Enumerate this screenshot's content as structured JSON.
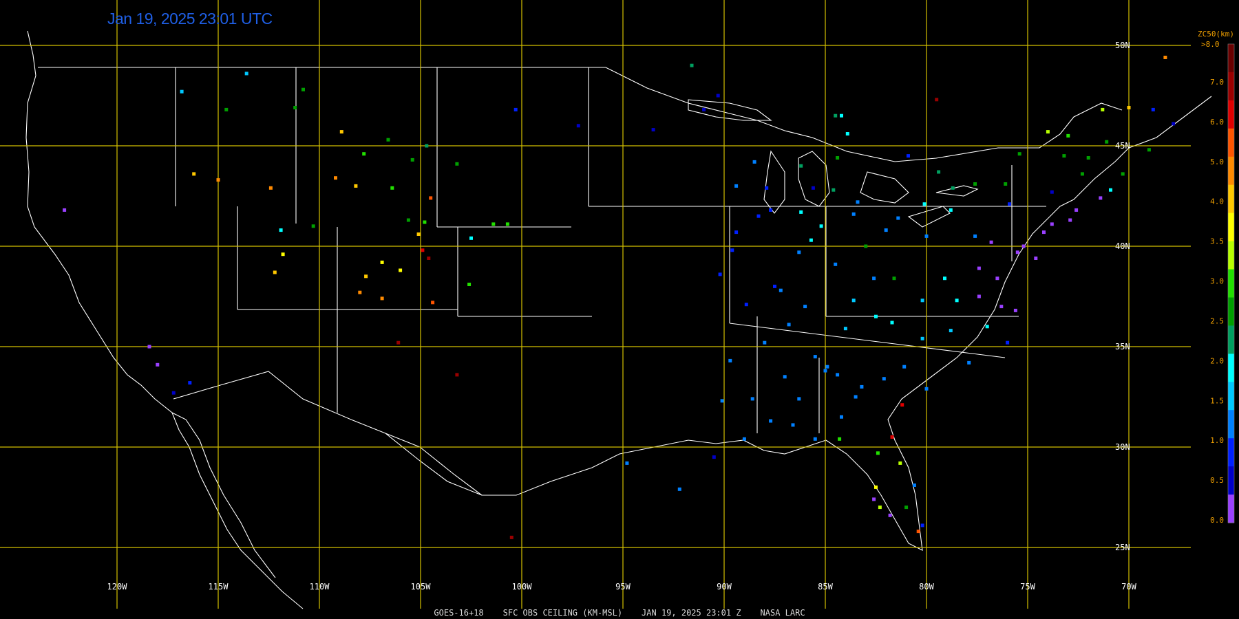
{
  "timestamp": "Jan 19, 2025 23:01 UTC",
  "footer": {
    "product": "GOES-16+18",
    "variable": "SFC OBS CEILING (KM-MSL)",
    "datetime": "JAN 19, 2025 23:01 Z",
    "source": "NASA LARC"
  },
  "colorbar": {
    "title": "ZC50(km)",
    "top_label": ">8.0",
    "labels": [
      "7.0",
      "6.0",
      "5.0",
      "4.0",
      "3.5",
      "3.0",
      "2.5",
      "2.0",
      "1.5",
      "1.0",
      "0.5",
      "0.0"
    ],
    "colors": [
      "#6a0000",
      "#9a0000",
      "#e00000",
      "#ff5500",
      "#ff8a00",
      "#ffc800",
      "#ffff00",
      "#b8ff00",
      "#22e000",
      "#00a000",
      "#00a060",
      "#00ffff",
      "#00c8ff",
      "#0080ff",
      "#0020ff",
      "#0000c8",
      "#9a40ff"
    ]
  },
  "colors": {
    "grid": "#d4c000",
    "border": "#ffffff",
    "background": "#000000",
    "timestamp": "#1f5fe6"
  },
  "grid": {
    "lon_labels": [
      "120W",
      "115W",
      "110W",
      "105W",
      "100W",
      "95W",
      "90W",
      "85W",
      "80W",
      "75W",
      "70W"
    ],
    "lat_labels": [
      "50N",
      "45N",
      "40N",
      "35N",
      "30N",
      "25N"
    ]
  },
  "observations": [
    {
      "lon": -113.6,
      "lat": 48.6,
      "c": "#00c8ff"
    },
    {
      "lon": -110.8,
      "lat": 47.8,
      "c": "#00a000"
    },
    {
      "lon": -111.2,
      "lat": 46.9,
      "c": "#00a000"
    },
    {
      "lon": -108.9,
      "lat": 45.7,
      "c": "#ffc800"
    },
    {
      "lon": -106.6,
      "lat": 45.3,
      "c": "#00a000"
    },
    {
      "lon": -104.7,
      "lat": 45.0,
      "c": "#00a060"
    },
    {
      "lon": -107.8,
      "lat": 44.6,
      "c": "#22e000"
    },
    {
      "lon": -105.4,
      "lat": 44.3,
      "c": "#00a000"
    },
    {
      "lon": -103.2,
      "lat": 44.1,
      "c": "#00a000"
    },
    {
      "lon": -109.2,
      "lat": 43.4,
      "c": "#ff8a00"
    },
    {
      "lon": -108.2,
      "lat": 43.0,
      "c": "#ffc800"
    },
    {
      "lon": -106.4,
      "lat": 42.9,
      "c": "#22e000"
    },
    {
      "lon": -104.5,
      "lat": 42.4,
      "c": "#ff5500"
    },
    {
      "lon": -105.6,
      "lat": 41.3,
      "c": "#00a000"
    },
    {
      "lon": -104.8,
      "lat": 41.2,
      "c": "#22e000"
    },
    {
      "lon": -105.1,
      "lat": 40.6,
      "c": "#ffc800"
    },
    {
      "lon": -104.9,
      "lat": 39.8,
      "c": "#e00000"
    },
    {
      "lon": -104.6,
      "lat": 39.4,
      "c": "#9a0000"
    },
    {
      "lon": -106.9,
      "lat": 39.2,
      "c": "#ffff00"
    },
    {
      "lon": -107.7,
      "lat": 38.5,
      "c": "#ffc800"
    },
    {
      "lon": -106.0,
      "lat": 38.8,
      "c": "#ffff00"
    },
    {
      "lon": -108.0,
      "lat": 37.7,
      "c": "#ff8a00"
    },
    {
      "lon": -106.9,
      "lat": 37.4,
      "c": "#ff8a00"
    },
    {
      "lon": -104.4,
      "lat": 37.2,
      "c": "#ff5500"
    },
    {
      "lon": -102.6,
      "lat": 38.1,
      "c": "#22e000"
    },
    {
      "lon": -102.5,
      "lat": 40.4,
      "c": "#00ffff"
    },
    {
      "lon": -101.4,
      "lat": 41.1,
      "c": "#22e000"
    },
    {
      "lon": -100.7,
      "lat": 41.1,
      "c": "#22e000"
    },
    {
      "lon": -116.2,
      "lat": 43.6,
      "c": "#ffc800"
    },
    {
      "lon": -115.0,
      "lat": 43.3,
      "c": "#ff8a00"
    },
    {
      "lon": -112.4,
      "lat": 42.9,
      "c": "#ff8a00"
    },
    {
      "lon": -111.9,
      "lat": 40.8,
      "c": "#00ffff"
    },
    {
      "lon": -110.3,
      "lat": 41.0,
      "c": "#00a000"
    },
    {
      "lon": -111.8,
      "lat": 39.6,
      "c": "#ffff00"
    },
    {
      "lon": -112.2,
      "lat": 38.7,
      "c": "#ffc800"
    },
    {
      "lon": -122.6,
      "lat": 41.8,
      "c": "#9a40ff"
    },
    {
      "lon": -118.4,
      "lat": 35.0,
      "c": "#9a40ff"
    },
    {
      "lon": -118.0,
      "lat": 34.1,
      "c": "#9a40ff"
    },
    {
      "lon": -117.2,
      "lat": 32.7,
      "c": "#0000c8"
    },
    {
      "lon": -116.4,
      "lat": 33.2,
      "c": "#0020ff"
    },
    {
      "lon": -114.6,
      "lat": 46.8,
      "c": "#00a000"
    },
    {
      "lon": -116.8,
      "lat": 47.7,
      "c": "#00c8ff"
    },
    {
      "lon": -100.3,
      "lat": 46.8,
      "c": "#0020ff"
    },
    {
      "lon": -97.2,
      "lat": 46.0,
      "c": "#0000c8"
    },
    {
      "lon": -106.1,
      "lat": 35.2,
      "c": "#9a0000"
    },
    {
      "lon": -103.2,
      "lat": 33.6,
      "c": "#9a0000"
    },
    {
      "lon": -100.5,
      "lat": 25.5,
      "c": "#9a0000"
    },
    {
      "lon": -94.8,
      "lat": 29.2,
      "c": "#0080ff"
    },
    {
      "lon": -92.2,
      "lat": 27.9,
      "c": "#0080ff"
    },
    {
      "lon": -90.5,
      "lat": 29.5,
      "c": "#0000c8"
    },
    {
      "lon": -87.0,
      "lat": 33.5,
      "c": "#0080ff"
    },
    {
      "lon": -86.3,
      "lat": 32.4,
      "c": "#0080ff"
    },
    {
      "lon": -85.0,
      "lat": 33.8,
      "c": "#0080ff"
    },
    {
      "lon": -84.4,
      "lat": 33.6,
      "c": "#0080ff"
    },
    {
      "lon": -83.5,
      "lat": 32.5,
      "c": "#0080ff"
    },
    {
      "lon": -86.8,
      "lat": 36.1,
      "c": "#0080ff"
    },
    {
      "lon": -85.5,
      "lat": 34.5,
      "c": "#0080ff"
    },
    {
      "lon": -84.0,
      "lat": 35.9,
      "c": "#00c8ff"
    },
    {
      "lon": -82.5,
      "lat": 36.5,
      "c": "#00ffff"
    },
    {
      "lon": -81.7,
      "lat": 36.2,
      "c": "#00ffff"
    },
    {
      "lon": -80.2,
      "lat": 35.4,
      "c": "#00c8ff"
    },
    {
      "lon": -84.5,
      "lat": 39.1,
      "c": "#0080ff"
    },
    {
      "lon": -83.0,
      "lat": 40.0,
      "c": "#00a000"
    },
    {
      "lon": -82.0,
      "lat": 40.8,
      "c": "#0080ff"
    },
    {
      "lon": -80.0,
      "lat": 40.5,
      "c": "#0080ff"
    },
    {
      "lon": -78.8,
      "lat": 41.8,
      "c": "#00ffff"
    },
    {
      "lon": -77.6,
      "lat": 40.5,
      "c": "#0080ff"
    },
    {
      "lon": -76.8,
      "lat": 40.2,
      "c": "#9a40ff"
    },
    {
      "lon": -75.2,
      "lat": 40.0,
      "c": "#9a40ff"
    },
    {
      "lon": -74.2,
      "lat": 40.7,
      "c": "#9a40ff"
    },
    {
      "lon": -73.8,
      "lat": 41.1,
      "c": "#9a40ff"
    },
    {
      "lon": -72.6,
      "lat": 41.8,
      "c": "#9a40ff"
    },
    {
      "lon": -71.4,
      "lat": 42.4,
      "c": "#9a40ff"
    },
    {
      "lon": -70.9,
      "lat": 42.8,
      "c": "#00ffff"
    },
    {
      "lon": -77.4,
      "lat": 38.9,
      "c": "#9a40ff"
    },
    {
      "lon": -76.5,
      "lat": 38.4,
      "c": "#9a40ff"
    },
    {
      "lon": -76.3,
      "lat": 37.0,
      "c": "#9a40ff"
    },
    {
      "lon": -77.4,
      "lat": 37.5,
      "c": "#9a40ff"
    },
    {
      "lon": -75.6,
      "lat": 36.8,
      "c": "#9a40ff"
    },
    {
      "lon": -76.0,
      "lat": 35.2,
      "c": "#0020ff"
    },
    {
      "lon": -77.9,
      "lat": 34.2,
      "c": "#0080ff"
    },
    {
      "lon": -80.0,
      "lat": 32.9,
      "c": "#0080ff"
    },
    {
      "lon": -81.2,
      "lat": 32.1,
      "c": "#e00000"
    },
    {
      "lon": -81.7,
      "lat": 30.5,
      "c": "#e00000"
    },
    {
      "lon": -82.4,
      "lat": 29.7,
      "c": "#22e000"
    },
    {
      "lon": -81.3,
      "lat": 29.2,
      "c": "#b8ff00"
    },
    {
      "lon": -82.5,
      "lat": 28.0,
      "c": "#ffff00"
    },
    {
      "lon": -82.6,
      "lat": 27.4,
      "c": "#9a40ff"
    },
    {
      "lon": -81.8,
      "lat": 26.6,
      "c": "#9a40ff"
    },
    {
      "lon": -80.6,
      "lat": 28.1,
      "c": "#0080ff"
    },
    {
      "lon": -80.2,
      "lat": 26.1,
      "c": "#0020ff"
    },
    {
      "lon": -80.4,
      "lat": 25.8,
      "c": "#ff5500"
    },
    {
      "lon": -81.0,
      "lat": 27.0,
      "c": "#00a000"
    },
    {
      "lon": -85.6,
      "lat": 42.9,
      "c": "#0000c8"
    },
    {
      "lon": -84.6,
      "lat": 42.8,
      "c": "#00a060"
    },
    {
      "lon": -83.4,
      "lat": 42.2,
      "c": "#0080ff"
    },
    {
      "lon": -84.4,
      "lat": 44.4,
      "c": "#00a000"
    },
    {
      "lon": -86.2,
      "lat": 44.0,
      "c": "#00a060"
    },
    {
      "lon": -87.9,
      "lat": 42.9,
      "c": "#0020ff"
    },
    {
      "lon": -87.7,
      "lat": 41.8,
      "c": "#0020ff"
    },
    {
      "lon": -86.2,
      "lat": 41.7,
      "c": "#00ffff"
    },
    {
      "lon": -89.6,
      "lat": 39.8,
      "c": "#0020ff"
    },
    {
      "lon": -89.4,
      "lat": 40.7,
      "c": "#0020ff"
    },
    {
      "lon": -88.3,
      "lat": 41.5,
      "c": "#0020ff"
    },
    {
      "lon": -90.2,
      "lat": 38.6,
      "c": "#0020ff"
    },
    {
      "lon": -85.7,
      "lat": 40.3,
      "c": "#00ffff"
    },
    {
      "lon": -84.2,
      "lat": 46.5,
      "c": "#00ffff"
    },
    {
      "lon": -83.9,
      "lat": 45.6,
      "c": "#00ffff"
    },
    {
      "lon": -80.9,
      "lat": 44.5,
      "c": "#0020ff"
    },
    {
      "lon": -79.4,
      "lat": 43.7,
      "c": "#00a060"
    },
    {
      "lon": -77.6,
      "lat": 43.1,
      "c": "#00a000"
    },
    {
      "lon": -76.1,
      "lat": 43.1,
      "c": "#00a000"
    },
    {
      "lon": -75.4,
      "lat": 44.6,
      "c": "#00a000"
    },
    {
      "lon": -73.8,
      "lat": 42.7,
      "c": "#0000c8"
    },
    {
      "lon": -72.0,
      "lat": 44.4,
      "c": "#00a000"
    },
    {
      "lon": -71.1,
      "lat": 45.2,
      "c": "#00a000"
    },
    {
      "lon": -69.0,
      "lat": 44.8,
      "c": "#00a000"
    },
    {
      "lon": -68.8,
      "lat": 46.8,
      "c": "#0020ff"
    },
    {
      "lon": -67.8,
      "lat": 46.1,
      "c": "#0000c8"
    },
    {
      "lon": -66.0,
      "lat": 45.3,
      "c": "#0000c8"
    },
    {
      "lon": -63.5,
      "lat": 44.9,
      "c": "#0020ff"
    },
    {
      "lon": -70.0,
      "lat": 46.9,
      "c": "#ffc800"
    },
    {
      "lon": -71.3,
      "lat": 46.8,
      "c": "#b8ff00"
    },
    {
      "lon": -73.0,
      "lat": 45.5,
      "c": "#22e000"
    },
    {
      "lon": -74.0,
      "lat": 45.7,
      "c": "#b8ff00"
    },
    {
      "lon": -66.3,
      "lat": 50.2,
      "c": "#ff8a00"
    },
    {
      "lon": -68.2,
      "lat": 49.4,
      "c": "#ff8a00"
    },
    {
      "lon": -64.5,
      "lat": 48.8,
      "c": "#ff8a00"
    },
    {
      "lon": -79.5,
      "lat": 47.3,
      "c": "#9a0000"
    },
    {
      "lon": -84.5,
      "lat": 46.5,
      "c": "#00a060"
    },
    {
      "lon": -90.3,
      "lat": 47.5,
      "c": "#0000c8"
    },
    {
      "lon": -91.0,
      "lat": 46.8,
      "c": "#0000c8"
    },
    {
      "lon": -93.5,
      "lat": 45.8,
      "c": "#0000c8"
    },
    {
      "lon": -91.6,
      "lat": 49.0,
      "c": "#00a060"
    },
    {
      "lon": -88.5,
      "lat": 44.2,
      "c": "#0080ff"
    },
    {
      "lon": -89.4,
      "lat": 43.0,
      "c": "#0080ff"
    },
    {
      "lon": -87.2,
      "lat": 37.8,
      "c": "#0080ff"
    },
    {
      "lon": -86.0,
      "lat": 37.0,
      "c": "#0080ff"
    },
    {
      "lon": -83.6,
      "lat": 37.3,
      "c": "#00c8ff"
    },
    {
      "lon": -82.6,
      "lat": 38.4,
      "c": "#0080ff"
    },
    {
      "lon": -81.6,
      "lat": 38.4,
      "c": "#00a000"
    },
    {
      "lon": -80.2,
      "lat": 37.3,
      "c": "#00c8ff"
    },
    {
      "lon": -79.1,
      "lat": 38.4,
      "c": "#00ffff"
    },
    {
      "lon": -78.5,
      "lat": 37.3,
      "c": "#00ffff"
    },
    {
      "lon": -84.9,
      "lat": 34.0,
      "c": "#0080ff"
    },
    {
      "lon": -83.2,
      "lat": 33.0,
      "c": "#0080ff"
    },
    {
      "lon": -88.6,
      "lat": 32.4,
      "c": "#0080ff"
    },
    {
      "lon": -87.7,
      "lat": 31.3,
      "c": "#0080ff"
    },
    {
      "lon": -86.6,
      "lat": 31.1,
      "c": "#0080ff"
    },
    {
      "lon": -84.2,
      "lat": 31.5,
      "c": "#0080ff"
    },
    {
      "lon": -82.1,
      "lat": 33.4,
      "c": "#0080ff"
    },
    {
      "lon": -81.1,
      "lat": 34.0,
      "c": "#0080ff"
    },
    {
      "lon": -77.0,
      "lat": 36.0,
      "c": "#00ffff"
    },
    {
      "lon": -78.8,
      "lat": 35.8,
      "c": "#00c8ff"
    },
    {
      "lon": -75.5,
      "lat": 39.7,
      "c": "#9a40ff"
    },
    {
      "lon": -74.6,
      "lat": 39.4,
      "c": "#9a40ff"
    },
    {
      "lon": -72.9,
      "lat": 41.3,
      "c": "#9a40ff"
    },
    {
      "lon": -70.3,
      "lat": 43.6,
      "c": "#00a000"
    },
    {
      "lon": -72.3,
      "lat": 43.6,
      "c": "#00a000"
    },
    {
      "lon": -73.2,
      "lat": 44.5,
      "c": "#00a000"
    },
    {
      "lon": -75.9,
      "lat": 42.1,
      "c": "#0020ff"
    },
    {
      "lon": -78.7,
      "lat": 42.9,
      "c": "#00a060"
    },
    {
      "lon": -80.1,
      "lat": 42.1,
      "c": "#00ffff"
    },
    {
      "lon": -81.4,
      "lat": 41.4,
      "c": "#0080ff"
    },
    {
      "lon": -83.6,
      "lat": 41.6,
      "c": "#0080ff"
    },
    {
      "lon": -85.2,
      "lat": 41.0,
      "c": "#00ffff"
    },
    {
      "lon": -86.3,
      "lat": 39.7,
      "c": "#0080ff"
    },
    {
      "lon": -87.5,
      "lat": 38.0,
      "c": "#0020ff"
    },
    {
      "lon": -88.9,
      "lat": 37.1,
      "c": "#0020ff"
    },
    {
      "lon": -88.0,
      "lat": 35.2,
      "c": "#0080ff"
    },
    {
      "lon": -89.7,
      "lat": 34.3,
      "c": "#0080ff"
    },
    {
      "lon": -90.1,
      "lat": 32.3,
      "c": "#0080ff"
    },
    {
      "lon": -89.0,
      "lat": 30.4,
      "c": "#0080ff"
    },
    {
      "lon": -85.5,
      "lat": 30.4,
      "c": "#0080ff"
    },
    {
      "lon": -84.3,
      "lat": 30.4,
      "c": "#22e000"
    },
    {
      "lon": -82.3,
      "lat": 27.0,
      "c": "#b8ff00"
    }
  ]
}
